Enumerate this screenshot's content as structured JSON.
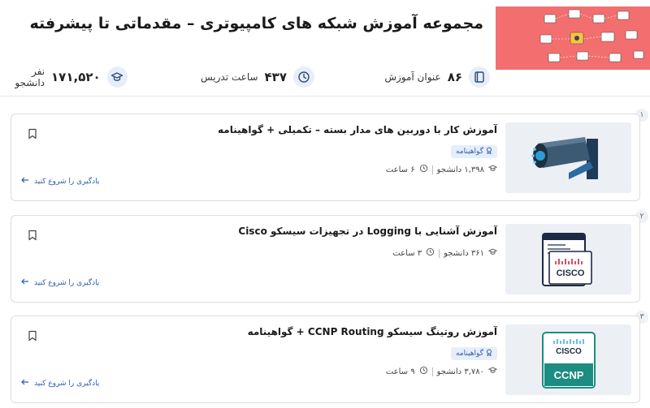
{
  "title": "مجموعه آموزش شبکه های کامپیوتری – مقدماتی تا پیشرفته",
  "stats": {
    "courses": {
      "value": "۸۶",
      "label": "عنوان آموزش"
    },
    "hours": {
      "value": "۴۳۷",
      "label": "ساعت تدریس"
    },
    "students": {
      "value": "۱۷۱,۵۲۰",
      "label": "نفر دانشجو"
    }
  },
  "courses": [
    {
      "index": "۱",
      "title": "آموزش کار با دوربین های مدار بسته – تکمیلی + گواهینامه",
      "badge": "گواهینامه",
      "students": "۱,۳۹۸ دانشجو",
      "duration": "۶ ساعت",
      "cta": "یادگیری را شروع کنید",
      "thumb_icon": "cctv-camera-icon"
    },
    {
      "index": "۲",
      "title": "آموزش آشنایی با Logging در تجهیزات سیسکو Cisco",
      "badge": "",
      "students": "۳۶۱ دانشجو",
      "duration": "۳ ساعت",
      "cta": "یادگیری را شروع کنید",
      "thumb_icon": "cisco-window-icon",
      "thumb_text": "CISCO"
    },
    {
      "index": "۳",
      "title": "آموزش روتینگ سیسکو CCNP Routing + گواهینامه",
      "badge": "گواهینامه",
      "students": "۳,۷۸۰ دانشجو",
      "duration": "۹ ساعت",
      "cta": "یادگیری را شروع کنید",
      "thumb_icon": "ccnp-badge-icon",
      "thumb_text": "CCNP",
      "thumb_brand": "CISCO"
    }
  ],
  "colors": {
    "accent": "#2a5db0",
    "header_bg": "#f36f6f",
    "badge_bg": "#e6eefb"
  }
}
